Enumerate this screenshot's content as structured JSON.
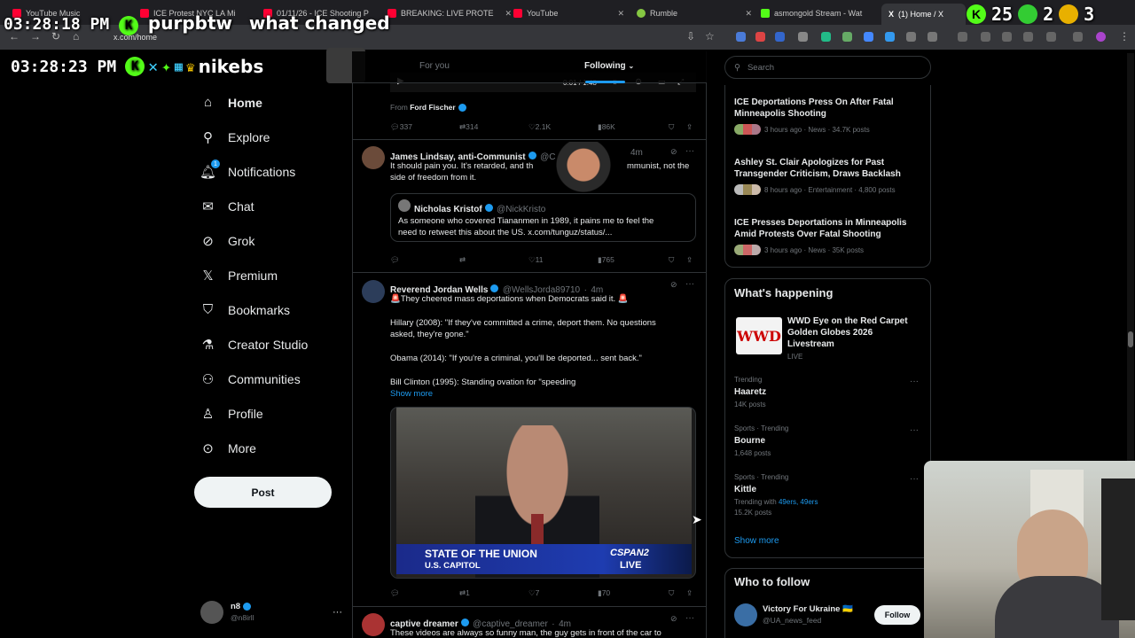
{
  "browser": {
    "tabs": [
      {
        "title": "YouTube Music",
        "color": "#ff0033"
      },
      {
        "title": "ICE Protest NYC LA Mi",
        "color": "#ff0033"
      },
      {
        "title": "01/11/26 - ICE Shooting P",
        "color": "#ff0033"
      },
      {
        "title": "BREAKING: LIVE PROTE",
        "color": "#ff0033"
      },
      {
        "title": "YouTube",
        "color": "#ff0033"
      },
      {
        "title": "Rumble",
        "color": "#85c742"
      },
      {
        "title": "asmongold Stream - Wat",
        "color": "#53fc18"
      },
      {
        "title": "(1) Home / X",
        "color": "#ffffff"
      }
    ],
    "url": "x.com/home"
  },
  "overlay": {
    "time1": "03:28:18 PM",
    "user1": "purpbtw",
    "message1": "what changed",
    "time2": "03:28:23 PM",
    "user2": "nikebs",
    "count_a": "25",
    "count_b": "2",
    "count_c": "3"
  },
  "sidebar": {
    "items": [
      {
        "label": "Home",
        "icon": "home-icon"
      },
      {
        "label": "Explore",
        "icon": "search-icon"
      },
      {
        "label": "Notifications",
        "icon": "bell-icon",
        "badge": "1"
      },
      {
        "label": "Chat",
        "icon": "mail-icon"
      },
      {
        "label": "Grok",
        "icon": "grok-icon"
      },
      {
        "label": "Premium",
        "icon": "x-icon"
      },
      {
        "label": "Bookmarks",
        "icon": "bookmark-icon"
      },
      {
        "label": "Creator Studio",
        "icon": "flask-icon"
      },
      {
        "label": "Communities",
        "icon": "people-icon"
      },
      {
        "label": "Profile",
        "icon": "person-icon"
      },
      {
        "label": "More",
        "icon": "more-icon"
      }
    ],
    "post_label": "Post",
    "account_name": "n8",
    "account_handle": "@n8irll"
  },
  "feed": {
    "tabs": {
      "for_you": "For you",
      "following": "Following"
    },
    "video_time": "0:01 / 1:48",
    "from_label": "From",
    "from_name": "Ford Fischer",
    "t0": {
      "replies": "337",
      "reposts": "314",
      "likes": "2.1K",
      "views": "86K"
    },
    "t1": {
      "name": "James Lindsay, anti-Communist",
      "handle": "@C",
      "time": "4m",
      "text": "It should pain you. It's retarded, and th",
      "text_tail": "mmunist, not the",
      "text2": "side of freedom from it.",
      "quote_name": "Nicholas Kristof",
      "quote_handle": "@NickKristo",
      "quote_text1": "As someone who covered Tiananmen in 1989, it pains me to feel the",
      "quote_text2": "need to retweet this about the US. x.com/tunguz/status/...",
      "replies": "",
      "reposts": "",
      "likes": "11",
      "views": "765"
    },
    "t2": {
      "name": "Reverend Jordan Wells",
      "handle": "@WellsJorda89710",
      "time": "4m",
      "text1": "🚨They cheered mass deportations when Democrats said it. 🚨",
      "text2": "Hillary (2008): \"If they've committed a crime, deport them. No questions",
      "text3": "asked, they're gone.\"",
      "text4": "Obama (2014): \"If you're a criminal, you'll be deported... sent back.\"",
      "text5": "Bill Clinton (1995): Standing ovation for \"speeding",
      "show_more": "Show more",
      "video_caption1": "STATE OF THE UNION",
      "video_caption2": "U.S. CAPITOL",
      "video_network": "CSPAN2",
      "video_live": "LIVE",
      "replies": "",
      "reposts": "1",
      "likes": "7",
      "views": "70"
    },
    "t3": {
      "name": "captive dreamer",
      "handle": "@captive_dreamer",
      "time": "4m",
      "text": "These videos are always so funny man, the guy gets in front of the car to"
    }
  },
  "right": {
    "search_placeholder": "Search",
    "news": [
      {
        "title": "ICE Deportations Press On After Fatal Minneapolis Shooting",
        "meta": "3 hours ago · News · 34.7K posts"
      },
      {
        "title": "Ashley St. Clair Apologizes for Past Transgender Criticism, Draws Backlash",
        "meta": "8 hours ago · Entertainment · 4,800 posts"
      },
      {
        "title": "ICE Presses Deportations in Minneapolis Amid Protests Over Fatal Shooting",
        "meta": "3 hours ago · News · 35K posts"
      }
    ],
    "happening_title": "What's happening",
    "event": {
      "title": "WWD Eye on the Red Carpet Golden Globes 2026 Livestream",
      "status": "LIVE",
      "logo": "WWD"
    },
    "trends": [
      {
        "context": "Trending",
        "name": "Haaretz",
        "posts": "14K posts"
      },
      {
        "context": "Sports · Trending",
        "name": "Bourne",
        "posts": "1,648 posts"
      },
      {
        "context": "Sports · Trending",
        "name": "Kittle",
        "with_label": "Trending with",
        "with_links": "49ers, 49ers",
        "posts": "15.2K posts"
      }
    ],
    "show_more": "Show more",
    "who_title": "Who to follow",
    "follow": {
      "name": "Victory For Ukraine 🇺🇦",
      "handle": "@UA_news_feed",
      "button": "Follow"
    }
  }
}
